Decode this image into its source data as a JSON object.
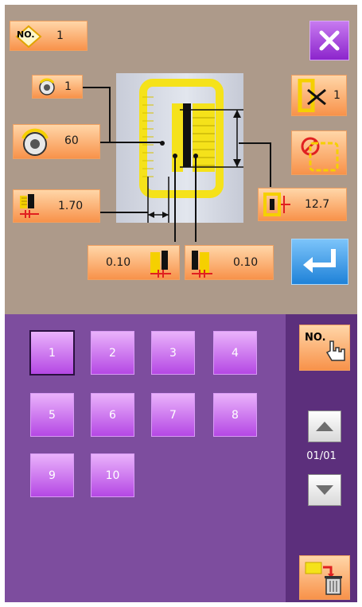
{
  "pattern_number": {
    "icon_label": "NO.",
    "value": "1"
  },
  "tension_count": "1",
  "tension_value": "60",
  "cut_length": "1.70",
  "left_width": "0.10",
  "right_width": "0.10",
  "buttonhole_length": "12.7",
  "sew_count": "1",
  "select_number_label": "NO.",
  "pattern_buttons": [
    "1",
    "2",
    "3",
    "4",
    "5",
    "6",
    "7",
    "8",
    "9",
    "10"
  ],
  "page_indicator": "01/01",
  "colors": {
    "accent_orange": "#f8924a",
    "pattern_purple": "#b548e4",
    "close_purple": "#9a2fd6",
    "enter_blue": "#2a8fe0",
    "background_top": "#ad9a8a",
    "background_bottom": "#7d4d9e"
  },
  "icons": [
    "close-icon",
    "enter-icon",
    "tension-dial-icon",
    "cut-length-icon",
    "left-width-icon",
    "right-width-icon",
    "buttonhole-length-icon",
    "sew-count-icon",
    "no-sew-icon",
    "hand-pointer-icon",
    "page-up-icon",
    "page-down-icon",
    "folder-delete-icon"
  ]
}
